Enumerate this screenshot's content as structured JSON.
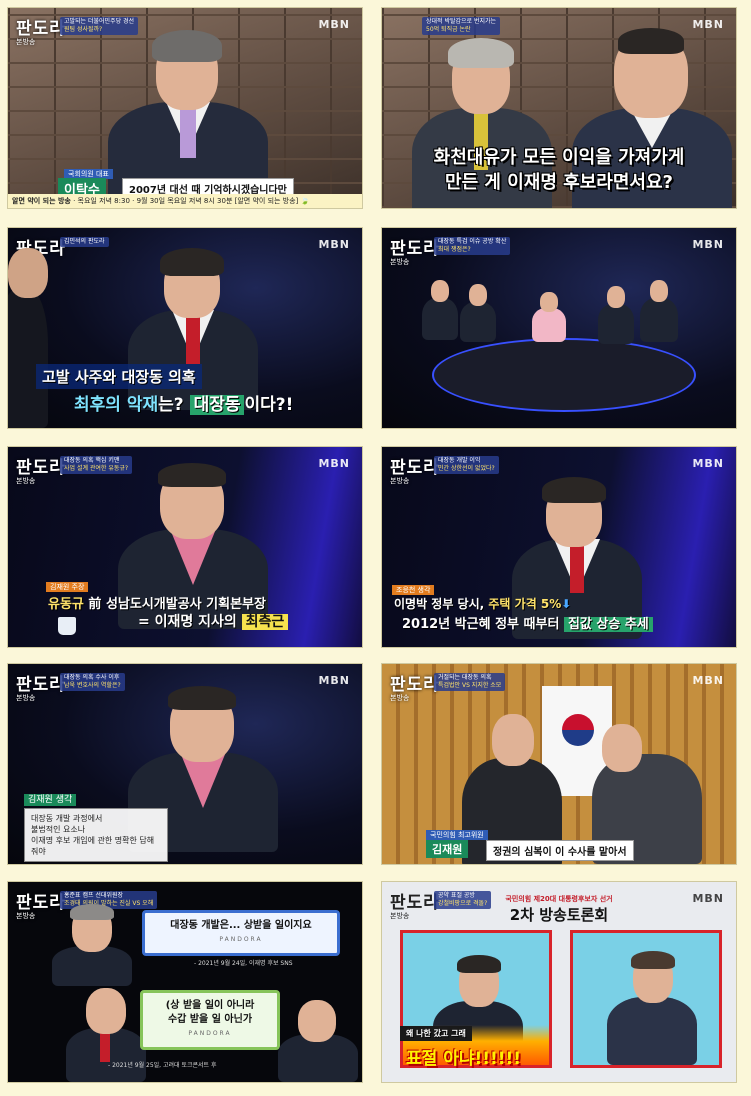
{
  "tiles": [
    {
      "logo": "판도라",
      "logo_sub": "본방송",
      "broadcaster": "MBN",
      "tag_line1": "고발되는 더불어민주당 경선",
      "tag_line2": "원팀 성사될까?",
      "name_label": "국회의원 대표",
      "name": "이탁수",
      "caption": "2007년 대선 때 기억하시겠습니다만",
      "ticker_left": "알면 약이 되는 방송",
      "ticker_mid": "목요일 저녁 8:30",
      "ticker_right": "9월 30일 목요일 저녁 8시 30분 [알면 약이 되는 방송] 🍃"
    },
    {
      "broadcaster": "MBN",
      "tag_line1": "상대적 박탈감으로 번지가는",
      "tag_line2": "50억 퇴직금 논란",
      "subtitle_line1": "화천대유가 모든 이익을 가져가게",
      "subtitle_line2": "만든 게 이재명 후보라면서요?"
    },
    {
      "logo": "판도라",
      "logo_sub": "본방송",
      "broadcaster": "MBN",
      "tag_line1": "김민석의 판도라",
      "caption_line1": "고발 사주와 대장동 의혹",
      "caption_line2a": "최후의 악재",
      "caption_line2b": "는?",
      "caption_line2c": "대장동",
      "caption_line2d": "이다?!"
    },
    {
      "logo": "판도라",
      "logo_sub": "본방송",
      "broadcaster": "MBN",
      "tag_line1": "대장동 특검 이슈 공방 확산",
      "tag_line2": "최대 쟁점은?"
    },
    {
      "logo": "판도라",
      "logo_sub": "본방송",
      "broadcaster": "MBN",
      "tag_line1": "대장동 의혹 핵심 키맨",
      "tag_line2": "사업 설계 관여한 유동규?",
      "name_label": "김재원 주장",
      "caption_line1a": "유동규",
      "caption_line1b": "前 성남도시개발공사 기획본부장",
      "caption_line2a": "= 이재명 지사의",
      "caption_line2b": "최측근"
    },
    {
      "logo": "판도라",
      "logo_sub": "본방송",
      "broadcaster": "MBN",
      "tag_line1": "대장동 개발 이익",
      "tag_line2": "민간 상한선이 없었다?",
      "name_label": "조응천 생각",
      "caption_line1a": "이명박 정부 당시,",
      "caption_line1b": "주택 가격 5%",
      "caption_line1c": "⬇",
      "caption_line2a": "2012년 박근혜 정부 때부터",
      "caption_line2b": "집값 상승 추세"
    },
    {
      "logo": "판도라",
      "logo_sub": "본방송",
      "broadcaster": "MBN",
      "tag_line1": "대장동 의혹 수사 이후",
      "tag_line2": "남욱 변호사의 역할은?",
      "name_label": "김재원 생각",
      "quote_line1": "대장동 개발 과정에서",
      "quote_line2": "불법적인 요소나",
      "quote_line3": "이재명 후보 개입에 관한 명확한 답해줘야"
    },
    {
      "logo": "판도라",
      "logo_sub": "본방송",
      "broadcaster": "MBN",
      "tag_line1": "거절되는 대장동 의혹",
      "tag_line2": "특검법안 VS 지지한 소모",
      "name_label": "국민의힘 최고위원",
      "name": "김재원",
      "caption": "정권의 심복이 이 수사를 맡아서"
    },
    {
      "logo": "판도라",
      "logo_sub": "본방송",
      "tag_line1": "홍준표 캠프 선대위원장",
      "tag_line2": "조경태 의원이 말하는 진실 VS 오해",
      "quote1_text": "대장동 개발은... 상받을 일이지요",
      "quote1_src": "PANDORA",
      "quote1_meta": "- 2021년 9월 24일, 이재명 후보 SNS",
      "quote2_line1": "(상 받을 일이 아니라",
      "quote2_line2": "수갑 받을 일 아닌가",
      "quote2_src": "PANDORA",
      "quote2_meta": "- 2021년 9월 25일, 고려대 토크콘서트 후"
    },
    {
      "logo": "판도라",
      "logo_sub": "본방송",
      "broadcaster": "MBN",
      "tag_line1": "공약 표절 공방",
      "tag_line2": "강철비팡으로 격돌?",
      "header_small": "국민의힘 제20대 대통령후보자 선거",
      "header_big": "2차 방송토론회",
      "bubble": "왜 나한 갔고 그래",
      "fire_caption": "표절 아냐!!!!!!"
    }
  ],
  "colors": {
    "background": "#fbf7d9",
    "caption_yellow": "#f6e24e",
    "caption_green": "#27a36b",
    "tie_red": "#c41e2a"
  }
}
